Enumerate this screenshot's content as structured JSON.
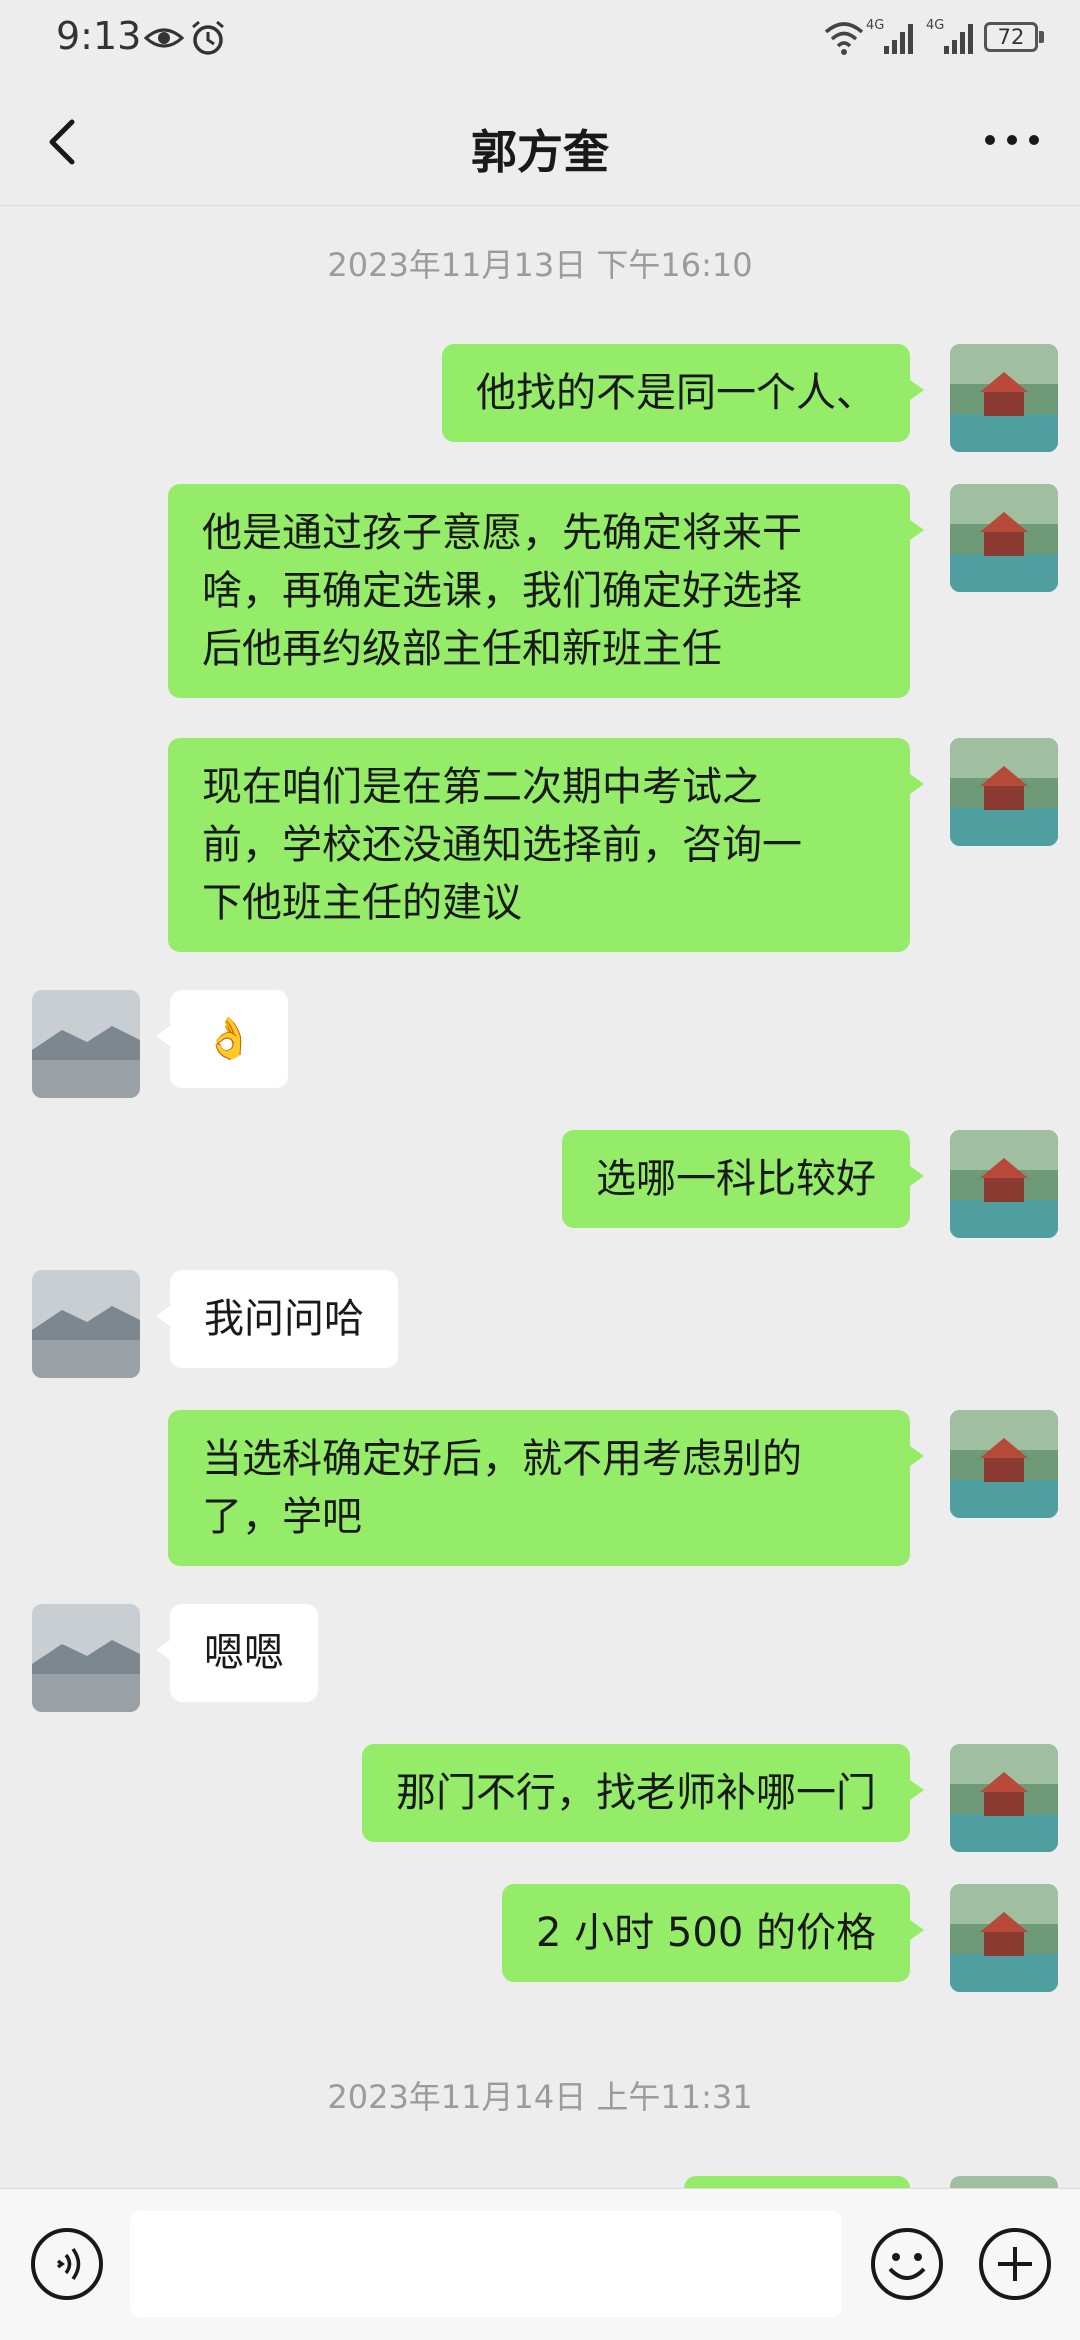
{
  "status_bar": {
    "time": "9:13",
    "battery": "72",
    "signal_1": "4G",
    "signal_2": "4G"
  },
  "header": {
    "title": "郭方奎"
  },
  "timestamps": [
    "2023年11月13日 下午16:10",
    "2023年11月14日 上午11:31"
  ],
  "messages": [
    {
      "from": "me",
      "text": "他找的不是同一个人、"
    },
    {
      "from": "me",
      "text": "他是通过孩子意愿，先确定将来干\n啥，再确定选课，我们确定好选择\n后他再约级部主任和新班主任"
    },
    {
      "from": "me",
      "text": "现在咱们是在第二次期中考试之\n前，学校还没通知选择前，咨询一\n下他班主任的建议"
    },
    {
      "from": "them",
      "text": "👌"
    },
    {
      "from": "me",
      "text": "选哪一科比较好"
    },
    {
      "from": "them",
      "text": "我问问哈"
    },
    {
      "from": "me",
      "text": "当选科确定好后，就不用考虑别的\n了，学吧"
    },
    {
      "from": "them",
      "text": "嗯嗯"
    },
    {
      "from": "me",
      "text": "那门不行，找老师补哪一门"
    },
    {
      "from": "me",
      "text": "2 小时 500 的价格"
    }
  ],
  "colors": {
    "sent_bubble": "#95ec69",
    "received_bubble": "#ffffff",
    "background": "#ededed"
  }
}
